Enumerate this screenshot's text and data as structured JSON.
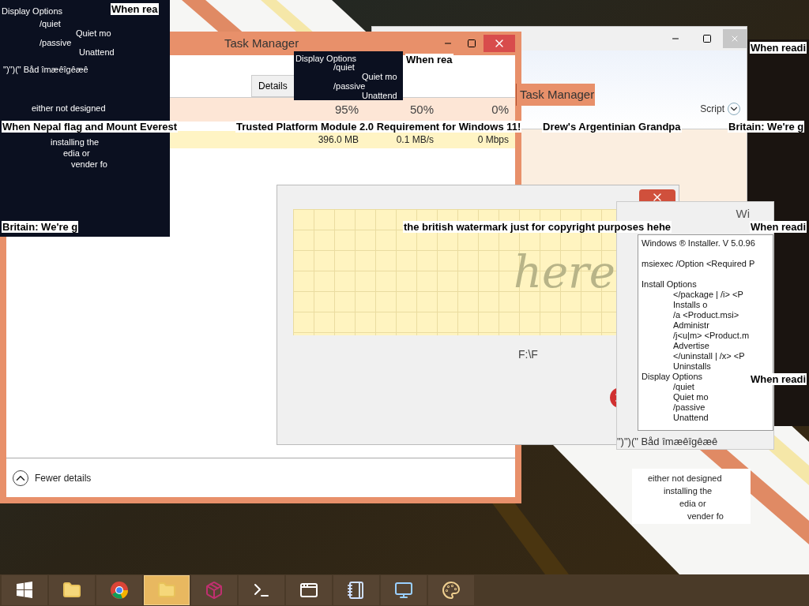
{
  "captions": [
    {
      "text": "When rea"
    },
    {
      "text": "When readi"
    },
    {
      "text": "When rea"
    },
    {
      "text": "When Nepal flag and Mount Everest"
    },
    {
      "text": "Trusted Platform Module 2.0 Requirement for Windows 11!"
    },
    {
      "text": "Drew's Argentinian Grandpa"
    },
    {
      "text": "Britain: We're g"
    },
    {
      "text": "Britain: We're g"
    },
    {
      "text": "the british watermark just for copyright purposes hehe"
    },
    {
      "text": "When readi"
    },
    {
      "text": "When readi"
    }
  ],
  "glitch_panels": [
    {
      "lines": [
        "Display Options",
        "/quiet",
        "Quiet mo",
        "/passive",
        "Unattend",
        "\")\")(\" Båd îmæêîgêæê",
        "either not designed",
        "installing the",
        "edia or",
        "vender fo"
      ]
    },
    {
      "lines": [
        "Display Options",
        "/quiet",
        "Quiet mo",
        "/passive",
        "Unattend"
      ]
    },
    {
      "lines": [
        "either not designed",
        "installing the",
        "edia or",
        "vender fo"
      ]
    }
  ],
  "task_manager": {
    "title": "Task Manager",
    "tabs": [
      {
        "label": "Details",
        "selected": false
      }
    ],
    "headers": [
      "95%",
      "50%",
      "0%"
    ],
    "values": [
      "396.0 MB",
      "0.1 MB/s",
      "0 Mbps"
    ],
    "footer": "Fewer details",
    "title_strip": "Task Manager"
  },
  "back_window": {
    "dropdown": "Script"
  },
  "error_dialog": {
    "handwriting": "here",
    "path": "F:\\F"
  },
  "installer_dialog": {
    "title": "Wi",
    "lines": [
      {
        "text": "Windows ® Installer. V 5.0.96",
        "indent": false
      },
      {
        "text": "msiexec /Option <Required P",
        "indent": false
      },
      {
        "text": "Install Options",
        "indent": false
      },
      {
        "text": "</package | /i> <P",
        "indent": true
      },
      {
        "text": "Installs o",
        "indent": true
      },
      {
        "text": "/a <Product.msi>",
        "indent": true
      },
      {
        "text": "Administr",
        "indent": true
      },
      {
        "text": "/j<u|m> <Product.m",
        "indent": true
      },
      {
        "text": "Advertise",
        "indent": true
      },
      {
        "text": "</uninstall | /x> <P",
        "indent": true
      },
      {
        "text": "Uninstalls",
        "indent": true
      },
      {
        "text": "Display Options",
        "indent": false
      },
      {
        "text": "/quiet",
        "indent": true
      },
      {
        "text": "Quiet mo",
        "indent": true
      },
      {
        "text": "/passive",
        "indent": true
      },
      {
        "text": "Unattend",
        "indent": true
      }
    ],
    "footer": "\")\")(\" Båd îmæêîgêæê"
  },
  "taskbar": [
    {
      "kind": "start",
      "selected": false
    },
    {
      "kind": "folder",
      "selected": false
    },
    {
      "kind": "browser",
      "selected": false
    },
    {
      "kind": "folder",
      "selected": true
    },
    {
      "kind": "archive",
      "selected": false
    },
    {
      "kind": "terminal",
      "selected": false
    },
    {
      "kind": "window",
      "selected": false
    },
    {
      "kind": "notebook",
      "selected": false
    },
    {
      "kind": "installer",
      "selected": false
    },
    {
      "kind": "palette",
      "selected": false
    }
  ]
}
